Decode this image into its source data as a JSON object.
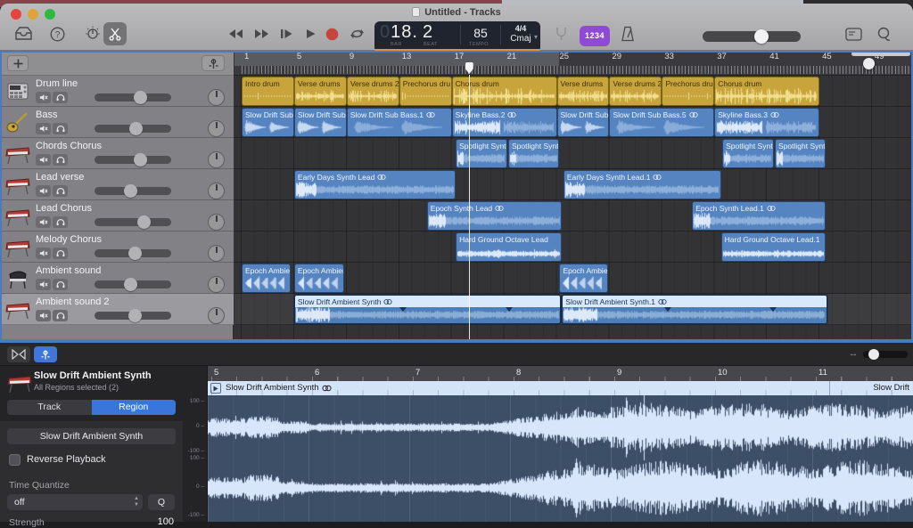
{
  "window": {
    "title": "Untitled - Tracks"
  },
  "toolbar": {
    "count_in_label": "1234",
    "master_volume_fraction": 0.62,
    "icons": [
      "library-icon",
      "quick-help-icon",
      "smart-controls-icon",
      "editors-icon",
      "rewind-icon",
      "fast-forward-icon",
      "go-to-beginning-icon",
      "play-icon",
      "record-icon",
      "cycle-icon",
      "tuner-icon",
      "metronome-icon",
      "display-mode-icon",
      "loop-browser-icon"
    ]
  },
  "lcd": {
    "bar_dim": "0",
    "bar_main": "18.",
    "beat": "2",
    "bar_label": "BAR",
    "beat_label": "BEAT",
    "tempo": "85",
    "tempo_label": "TEMPO",
    "time_signature": "4/4",
    "key": "Cmaj"
  },
  "colors": {
    "accent_blue": "#3f76d8",
    "focus_ring": "#4a7ac2",
    "region_yellow": "#c8a43c",
    "region_blue": "#5584c1",
    "selected_region_header": "#d9e8fb",
    "lcd_orange": "#e2923f",
    "record_red": "#c6453c",
    "count_in_purple": "#8e4ad4",
    "editor_wave_bg": "#3d4e67",
    "wave_color": "#d7e6fb"
  },
  "tracks": [
    {
      "name": "Drum line",
      "icon": "drum-machine-icon",
      "volume": 0.62,
      "selected": false
    },
    {
      "name": "Bass",
      "icon": "bass-guitar-icon",
      "volume": 0.55,
      "selected": false
    },
    {
      "name": "Chords Chorus",
      "icon": "keyboard-icon",
      "volume": 0.62,
      "selected": false
    },
    {
      "name": "Lead verse",
      "icon": "keyboard-icon",
      "volume": 0.47,
      "selected": false
    },
    {
      "name": "Lead Chorus",
      "icon": "keyboard-icon",
      "volume": 0.68,
      "selected": false
    },
    {
      "name": "Melody Chorus",
      "icon": "keyboard-icon",
      "volume": 0.53,
      "selected": false
    },
    {
      "name": "Ambient sound",
      "icon": "grand-piano-icon",
      "volume": 0.47,
      "selected": false
    },
    {
      "name": "Ambient sound 2",
      "icon": "keyboard-icon",
      "volume": 0.53,
      "selected": true
    }
  ],
  "timeline": {
    "ruler_numbers": [
      1,
      5,
      9,
      13,
      17,
      21,
      25,
      29,
      33,
      37,
      41,
      45,
      49
    ],
    "playhead_bar": 18.3,
    "highlight_range": [
      1,
      25.2
    ],
    "rows": [
      [
        {
          "label": "Intro drum",
          "start": 1,
          "end": 5,
          "color": "yellow",
          "wave": "dots"
        },
        {
          "label": "Verse drums",
          "start": 5,
          "end": 9,
          "color": "yellow",
          "wave": "drums"
        },
        {
          "label": "Verse drums 2",
          "start": 9,
          "end": 13,
          "color": "yellow",
          "wave": "drums"
        },
        {
          "label": "Prechorus dru",
          "start": 13,
          "end": 17,
          "color": "yellow",
          "wave": "dots"
        },
        {
          "label": "Chorus drum",
          "start": 17,
          "end": 25,
          "color": "yellow",
          "wave": "drumsBig"
        },
        {
          "label": "Verse drums",
          "start": 25,
          "end": 29,
          "color": "yellow",
          "wave": "drums"
        },
        {
          "label": "Verse drums 2",
          "start": 29,
          "end": 33,
          "color": "yellow",
          "wave": "drums"
        },
        {
          "label": "Prechorus dru",
          "start": 33,
          "end": 37,
          "color": "yellow",
          "wave": "dots"
        },
        {
          "label": "Chorus drum",
          "start": 37,
          "end": 45,
          "color": "yellow",
          "wave": "drumsBig"
        }
      ],
      [
        {
          "label": "Slow Drift Sub",
          "start": 1,
          "end": 5,
          "color": "blue",
          "wave": "burst"
        },
        {
          "label": "Slow Drift Sub",
          "start": 5,
          "end": 9,
          "color": "blue",
          "wave": "burst"
        },
        {
          "label": "Slow Drift Sub Bass.1",
          "start": 9,
          "end": 17,
          "color": "blue",
          "wave": "softburst",
          "loop_icon": true
        },
        {
          "label": "Skyline Bass.2",
          "start": 17,
          "end": 25,
          "color": "blue",
          "wave": "skyline",
          "loop_icon": true
        },
        {
          "label": "Slow Drift Sub",
          "start": 25,
          "end": 29,
          "color": "blue",
          "wave": "burst"
        },
        {
          "label": "Slow Drift Sub Bass.5",
          "start": 29,
          "end": 37,
          "color": "blue",
          "wave": "softburst",
          "loop_icon": true
        },
        {
          "label": "Skyline Bass.3",
          "start": 37,
          "end": 45,
          "color": "blue",
          "wave": "skyline",
          "loop_icon": true
        }
      ],
      [
        {
          "label": "Spotlight Synt",
          "start": 17.3,
          "end": 21.2,
          "color": "blue",
          "wave": "band"
        },
        {
          "label": "Spotlight Synt",
          "start": 21.3,
          "end": 25.2,
          "color": "blue",
          "wave": "band"
        },
        {
          "label": "Spotlight Synt",
          "start": 37.6,
          "end": 41.5,
          "color": "blue",
          "wave": "band"
        },
        {
          "label": "Spotlight Synt",
          "start": 41.6,
          "end": 45.5,
          "color": "blue",
          "wave": "band"
        }
      ],
      [
        {
          "label": "Early Days Synth Lead",
          "start": 5,
          "end": 17.3,
          "color": "blue",
          "wave": "band",
          "loop_icon": true
        },
        {
          "label": "Early Days Synth Lead.1",
          "start": 25.5,
          "end": 37.5,
          "color": "blue",
          "wave": "band",
          "loop_icon": true
        }
      ],
      [
        {
          "label": "Epoch Synth Lead",
          "start": 15.1,
          "end": 25.4,
          "color": "blue",
          "wave": "band",
          "loop_icon": true
        },
        {
          "label": "Epoch Synth Lead.1",
          "start": 35.3,
          "end": 45.5,
          "color": "blue",
          "wave": "band",
          "loop_icon": true
        }
      ],
      [
        {
          "label": "Hard Ground Octave Lead",
          "start": 17.3,
          "end": 25.4,
          "color": "blue",
          "wave": "line"
        },
        {
          "label": "Hard Ground Octave Lead.1",
          "start": 37.5,
          "end": 45.5,
          "color": "blue",
          "wave": "line"
        }
      ],
      [
        {
          "label": "Epoch Ambien",
          "start": 1,
          "end": 4.7,
          "color": "blue",
          "wave": "ambient"
        },
        {
          "label": "Epoch Ambien",
          "start": 5,
          "end": 8.8,
          "color": "blue",
          "wave": "ambient"
        },
        {
          "label": "Epoch Ambien",
          "start": 25.2,
          "end": 28.9,
          "color": "blue",
          "wave": "ambient"
        }
      ],
      [
        {
          "label": "Slow Drift Ambient Synth",
          "start": 5,
          "end": 25.3,
          "color": "selblue",
          "wave": "band",
          "loop_icon": true,
          "selected": true,
          "notches": [
            13.2,
            21.3
          ]
        },
        {
          "label": "Slow Drift Ambient Synth.1",
          "start": 25.4,
          "end": 45.6,
          "color": "selblue",
          "wave": "band",
          "loop_icon": true,
          "selected": true,
          "notches": [
            33.4,
            41.4
          ]
        }
      ]
    ]
  },
  "editor": {
    "title": "Slow Drift Ambient Synth",
    "subtitle": "All Regions selected (2)",
    "tabs": [
      {
        "label": "Track",
        "active": false
      },
      {
        "label": "Region",
        "active": true
      }
    ],
    "region_name": "Slow Drift Ambient Synth",
    "reverse_playback_label": "Reverse Playback",
    "time_quantize_label": "Time Quantize",
    "time_quantize_value": "off",
    "q_button_label": "Q",
    "strength_label": "Strength",
    "strength_value": "100",
    "ruler_bars": [
      5,
      6,
      7,
      8,
      9,
      10,
      11
    ],
    "region_header_label": "Slow Drift Ambient Synth",
    "region_header_label_right": "Slow Drift",
    "scale_labels": [
      "100",
      "0",
      "-100",
      "100",
      "0",
      "-100"
    ]
  }
}
